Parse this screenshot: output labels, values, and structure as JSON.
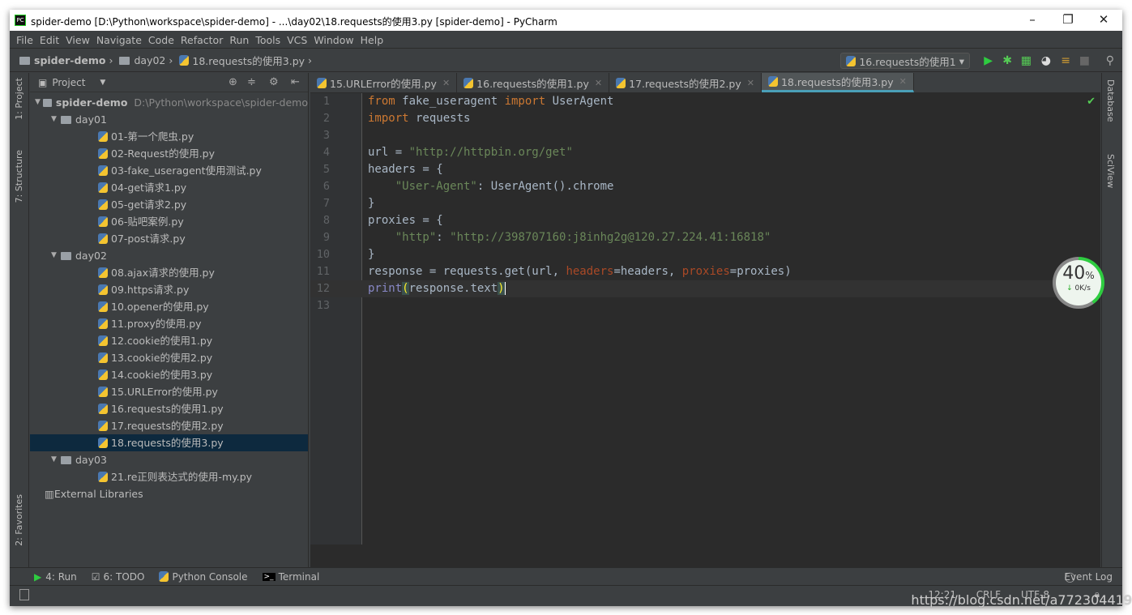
{
  "window": {
    "title": "spider-demo [D:\\Python\\workspace\\spider-demo] - ...\\day02\\18.requests的使用3.py [spider-demo] - PyCharm",
    "logo": "PC"
  },
  "menu": [
    "File",
    "Edit",
    "View",
    "Navigate",
    "Code",
    "Refactor",
    "Run",
    "Tools",
    "VCS",
    "Window",
    "Help"
  ],
  "breadcrumb": [
    "spider-demo",
    "day02",
    "18.requests的使用3.py"
  ],
  "run_config": "16.requests的使用1",
  "left_tabs": [
    "1: Project",
    "7: Structure",
    "2: Favorites"
  ],
  "right_tabs": [
    "Database",
    "SciView"
  ],
  "project": {
    "header": "Project",
    "tree": [
      {
        "label": "spider-demo",
        "path": "D:\\Python\\workspace\\spider-demo",
        "depth": 0,
        "type": "root"
      },
      {
        "label": "day01",
        "depth": 1,
        "type": "folder"
      },
      {
        "label": "01-第一个爬虫.py",
        "depth": 2,
        "type": "file"
      },
      {
        "label": "02-Request的使用.py",
        "depth": 2,
        "type": "file"
      },
      {
        "label": "03-fake_useragent使用测试.py",
        "depth": 2,
        "type": "file"
      },
      {
        "label": "04-get请求1.py",
        "depth": 2,
        "type": "file"
      },
      {
        "label": "05-get请求2.py",
        "depth": 2,
        "type": "file"
      },
      {
        "label": "06-贴吧案例.py",
        "depth": 2,
        "type": "file"
      },
      {
        "label": "07-post请求.py",
        "depth": 2,
        "type": "file"
      },
      {
        "label": "day02",
        "depth": 1,
        "type": "folder"
      },
      {
        "label": "08.ajax请求的使用.py",
        "depth": 2,
        "type": "file"
      },
      {
        "label": "09.https请求.py",
        "depth": 2,
        "type": "file"
      },
      {
        "label": "10.opener的使用.py",
        "depth": 2,
        "type": "file"
      },
      {
        "label": "11.proxy的使用.py",
        "depth": 2,
        "type": "file"
      },
      {
        "label": "12.cookie的使用1.py",
        "depth": 2,
        "type": "file"
      },
      {
        "label": "13.cookie的使用2.py",
        "depth": 2,
        "type": "file"
      },
      {
        "label": "14.cookie的使用3.py",
        "depth": 2,
        "type": "file"
      },
      {
        "label": "15.URLError的使用.py",
        "depth": 2,
        "type": "file"
      },
      {
        "label": "16.requests的使用1.py",
        "depth": 2,
        "type": "file"
      },
      {
        "label": "17.requests的使用2.py",
        "depth": 2,
        "type": "file"
      },
      {
        "label": "18.requests的使用3.py",
        "depth": 2,
        "type": "file",
        "selected": true
      },
      {
        "label": "day03",
        "depth": 1,
        "type": "folder"
      },
      {
        "label": "21.re正则表达式的使用-my.py",
        "depth": 2,
        "type": "file"
      },
      {
        "label": "External Libraries",
        "depth": 0,
        "type": "lib"
      }
    ]
  },
  "tabs": [
    {
      "label": "15.URLError的使用.py"
    },
    {
      "label": "16.requests的使用1.py"
    },
    {
      "label": "17.requests的使用2.py"
    },
    {
      "label": "18.requests的使用3.py",
      "active": true
    }
  ],
  "code": [
    [
      [
        "from",
        "kw"
      ],
      [
        " fake_useragent ",
        ""
      ],
      [
        "import",
        "kw"
      ],
      [
        " UserAgent",
        ""
      ]
    ],
    [
      [
        "import",
        "kw"
      ],
      [
        " requests",
        ""
      ]
    ],
    [],
    [
      [
        "url = ",
        ""
      ],
      [
        "\"http://httpbin.org/get\"",
        "str"
      ]
    ],
    [
      [
        "headers = {",
        ""
      ]
    ],
    [
      [
        "    ",
        ""
      ],
      [
        "\"User-Agent\"",
        "str"
      ],
      [
        ": UserAgent().chrome",
        ""
      ]
    ],
    [
      [
        "}",
        ""
      ]
    ],
    [
      [
        "proxies = {",
        ""
      ]
    ],
    [
      [
        "    ",
        ""
      ],
      [
        "\"http\"",
        "str"
      ],
      [
        ": ",
        ""
      ],
      [
        "\"http://398707160:j8inhg2g@120.27.224.41:16818\"",
        "str"
      ]
    ],
    [
      [
        "}",
        ""
      ]
    ],
    [
      [
        "response = requests.get(url, ",
        ""
      ],
      [
        "headers",
        "param"
      ],
      [
        "=headers, ",
        ""
      ],
      [
        "proxies",
        "param"
      ],
      [
        "=proxies)",
        ""
      ]
    ],
    [
      [
        "print",
        "bi"
      ],
      [
        "(",
        "brace"
      ],
      [
        "response.text",
        ""
      ],
      [
        ")",
        "brace"
      ]
    ],
    []
  ],
  "current_line": 12,
  "bottom_tools": [
    "4: Run",
    "6: TODO",
    "Python Console",
    "Terminal"
  ],
  "event_log": "Event Log",
  "status": {
    "position": "12:21",
    "line_sep": "CRLF",
    "encoding": "UTF-8"
  },
  "watermark": "https://blog.csdn.net/a772304419",
  "net_widget": {
    "percent": 40,
    "percent_label": "40",
    "unit": "%",
    "speed": "0K/s"
  },
  "colors": {
    "keyword": "#cc7832",
    "string": "#6a8759",
    "param": "#aa4926",
    "accent": "#4a9fb8",
    "run": "#2ecc40"
  }
}
